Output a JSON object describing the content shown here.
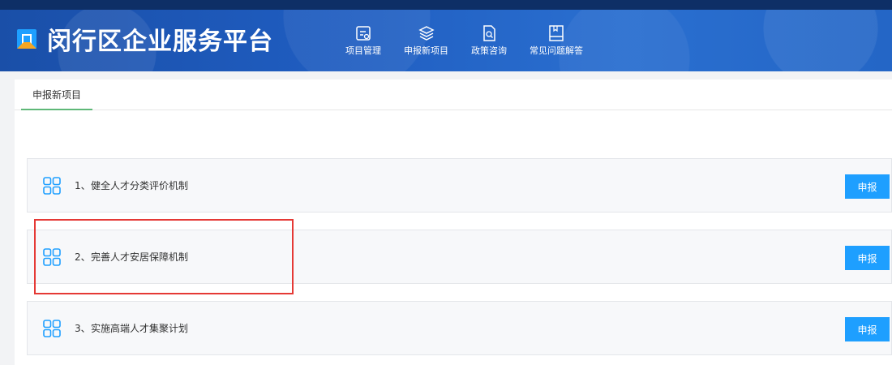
{
  "header": {
    "site_title": "闵行区企业服务平台",
    "nav": [
      {
        "label": "项目管理",
        "icon": "project-folder-icon"
      },
      {
        "label": "申报新项目",
        "icon": "layers-icon"
      },
      {
        "label": "政策咨询",
        "icon": "document-search-icon"
      },
      {
        "label": "常见问题解答",
        "icon": "book-icon"
      }
    ]
  },
  "tabs": [
    {
      "label": "申报新项目",
      "active": true
    }
  ],
  "projects": [
    {
      "number": "1、",
      "title": "健全人才分类评价机制",
      "button": "申报"
    },
    {
      "number": "2、",
      "title": "完善人才安居保障机制",
      "button": "申报"
    },
    {
      "number": "3、",
      "title": "实施高端人才集聚计划",
      "button": "申报"
    }
  ],
  "colors": {
    "header": "#1f5cbf",
    "button": "#1e9fff",
    "tab_underline": "#5fb878",
    "project_icon": "#1e9fff",
    "highlight": "#e53935"
  }
}
